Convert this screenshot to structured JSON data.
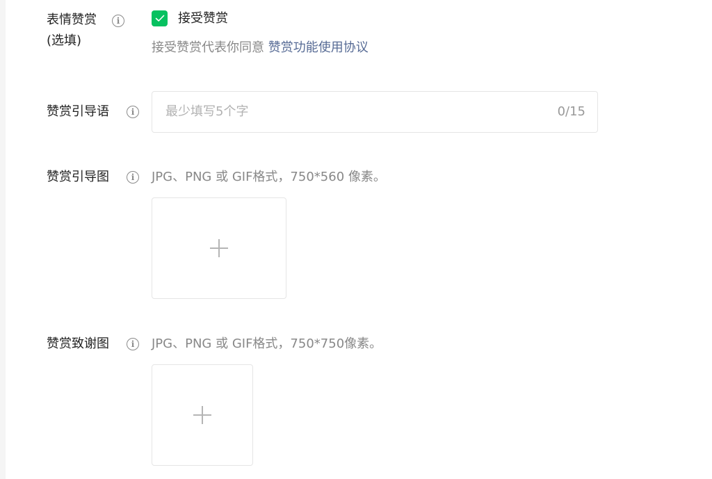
{
  "colors": {
    "accent_green": "#07c160",
    "link_blue": "#576b95",
    "label_text": "#222222",
    "hint_text": "#888888",
    "placeholder_text": "#b2b2b2",
    "border": "#e5e5e5"
  },
  "reward": {
    "label": "表情赞赏",
    "label_suffix": "(选填)",
    "info_icon": "info-circle-icon",
    "checkbox_checked": true,
    "checkbox_label": "接受赞赏",
    "agreement_prefix": "接受赞赏代表你同意 ",
    "agreement_link": "赞赏功能使用协议"
  },
  "guide_text": {
    "label": "赞赏引导语",
    "info_icon": "info-circle-icon",
    "placeholder": "最少填写5个字",
    "value": "",
    "counter": "0/15"
  },
  "guide_image": {
    "label": "赞赏引导图",
    "info_icon": "info-circle-icon",
    "hint": "JPG、PNG 或 GIF格式，750*560 像素。",
    "upload_icon": "plus-icon"
  },
  "thanks_image": {
    "label": "赞赏致谢图",
    "info_icon": "info-circle-icon",
    "hint": "JPG、PNG 或 GIF格式，750*750像素。",
    "upload_icon": "plus-icon"
  }
}
